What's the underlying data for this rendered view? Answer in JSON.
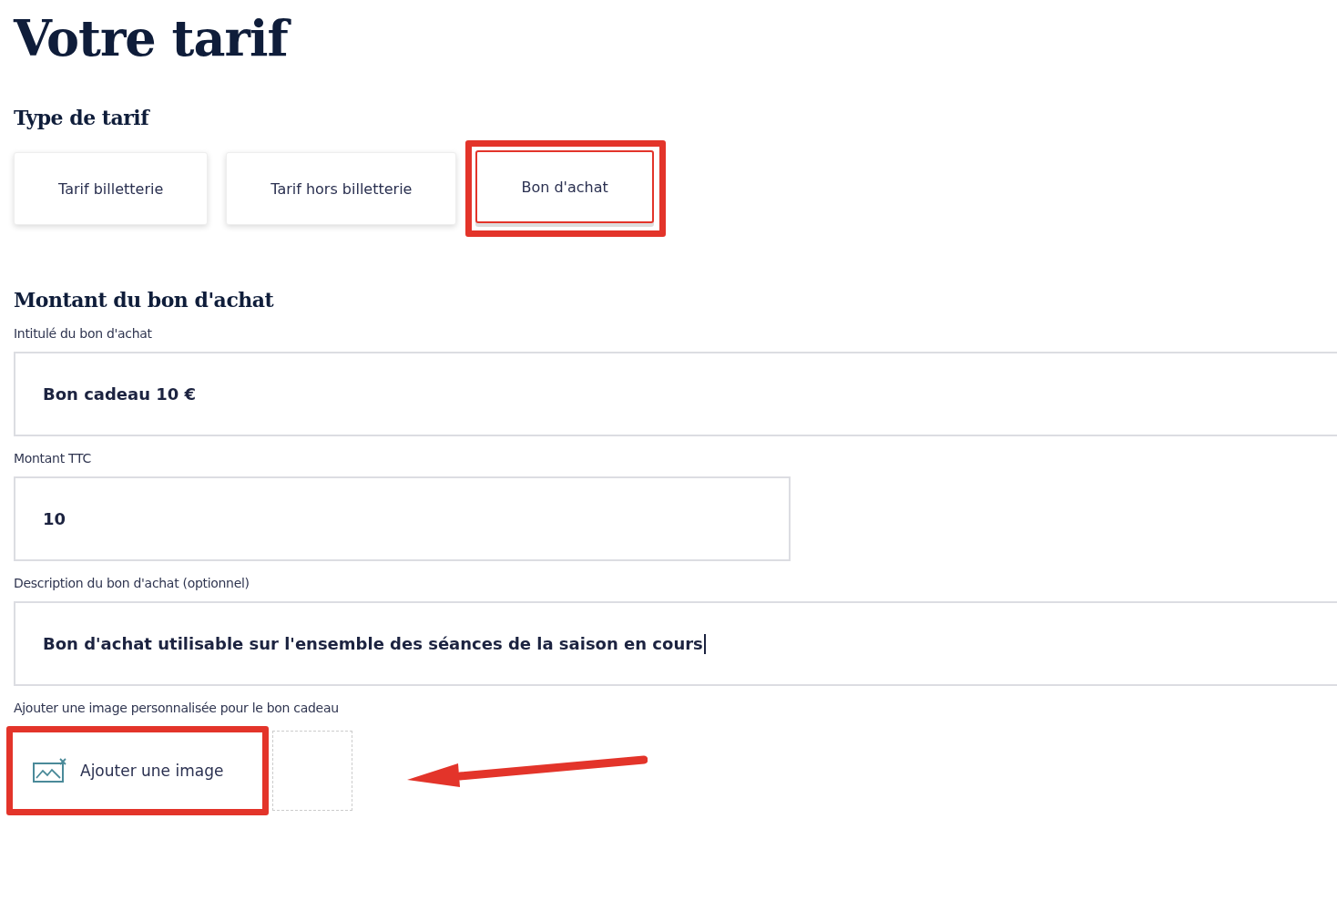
{
  "title": "Votre tarif",
  "tariff_type": {
    "heading": "Type de tarif",
    "tabs": [
      {
        "label": "Tarif billetterie",
        "selected": false,
        "highlighted": false
      },
      {
        "label": "Tarif hors billetterie",
        "selected": false,
        "highlighted": false
      },
      {
        "label": "Bon d'achat",
        "selected": true,
        "highlighted": true
      }
    ]
  },
  "voucher": {
    "heading": "Montant du bon d'achat",
    "fields": [
      {
        "label": "Intitulé du bon d'achat",
        "value": "Bon cadeau 10 €",
        "kind": "wide",
        "focused": false
      },
      {
        "label": "Montant TTC",
        "value": "10",
        "kind": "narrow",
        "focused": false
      },
      {
        "label": "Description du bon d'achat (optionnel)",
        "value": "Bon d'achat utilisable sur l'ensemble des séances de la saison en cours",
        "kind": "wide",
        "focused": true
      }
    ],
    "image": {
      "label": "Ajouter une image personnalisée pour le bon cadeau",
      "button": "Ajouter une image",
      "highlighted": true,
      "arrow": true
    }
  }
}
